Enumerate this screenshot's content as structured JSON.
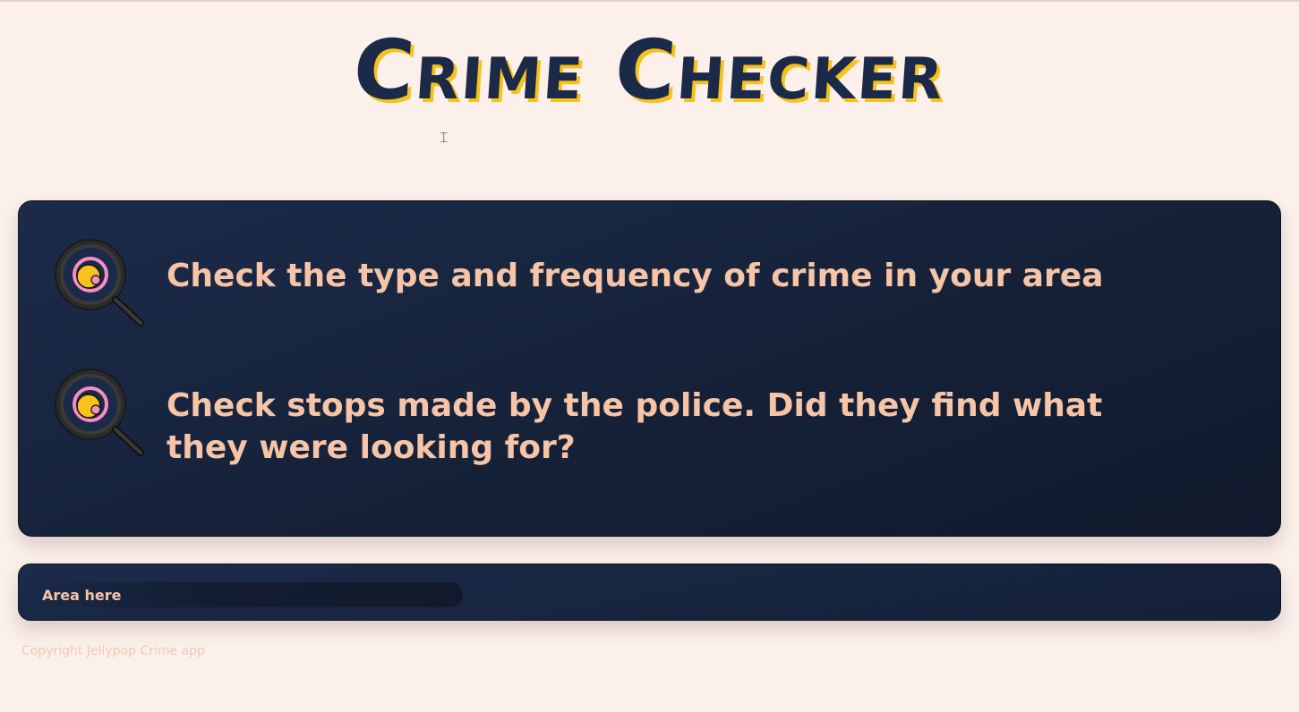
{
  "header": {
    "title": "Crime Checker"
  },
  "features": [
    {
      "icon": "magnifier-icon",
      "text": "Check the type and frequency of crime in your area"
    },
    {
      "icon": "magnifier-icon",
      "text": "Check stops made by the police. Did they find what they were looking for?"
    }
  ],
  "search": {
    "placeholder": "Area here"
  },
  "footer": {
    "copyright": "Copyright Jellypop Crime app"
  },
  "colors": {
    "background": "#fcf0eb",
    "card": "#1b2a48",
    "title": "#1b2a48",
    "title_shadow": "#f6c21b",
    "text_accent": "#f6c4a6",
    "icon_pink": "#f48fc5",
    "icon_yellow": "#f6c21b"
  }
}
